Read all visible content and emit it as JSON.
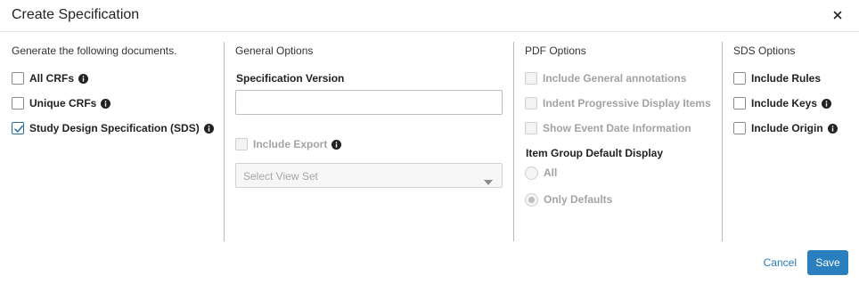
{
  "dialog": {
    "title": "Create Specification",
    "close_icon": "close-icon"
  },
  "documents": {
    "heading": "Generate the following documents.",
    "items": [
      {
        "label": "All CRFs",
        "checked": false,
        "info": true
      },
      {
        "label": "Unique CRFs",
        "checked": false,
        "info": true
      },
      {
        "label": "Study Design Specification (SDS)",
        "checked": true,
        "info": true
      }
    ]
  },
  "general": {
    "heading": "General Options",
    "version_label": "Specification Version",
    "version_value": "",
    "include_export_label": "Include Export",
    "include_export_checked": false,
    "view_set_placeholder": "Select View Set"
  },
  "pdf": {
    "heading": "PDF Options",
    "items": [
      {
        "label": "Include General annotations",
        "checked": false,
        "disabled": true
      },
      {
        "label": "Indent Progressive Display Items",
        "checked": false,
        "disabled": true
      },
      {
        "label": "Show Event Date Information",
        "checked": false,
        "disabled": true
      }
    ],
    "group_display_label": "Item Group Default Display",
    "group_display_options": [
      {
        "label": "All",
        "selected": false
      },
      {
        "label": "Only Defaults",
        "selected": true
      }
    ]
  },
  "sds": {
    "heading": "SDS Options",
    "items": [
      {
        "label": "Include Rules",
        "checked": false,
        "info": false
      },
      {
        "label": "Include Keys",
        "checked": false,
        "info": true
      },
      {
        "label": "Include Origin",
        "checked": false,
        "info": true
      }
    ]
  },
  "footer": {
    "cancel_label": "Cancel",
    "save_label": "Save"
  },
  "colors": {
    "primary": "#2a7fbf",
    "link": "#2a7ab8",
    "divider": "#b8b8b8",
    "disabled_text": "#a3a3a3"
  }
}
